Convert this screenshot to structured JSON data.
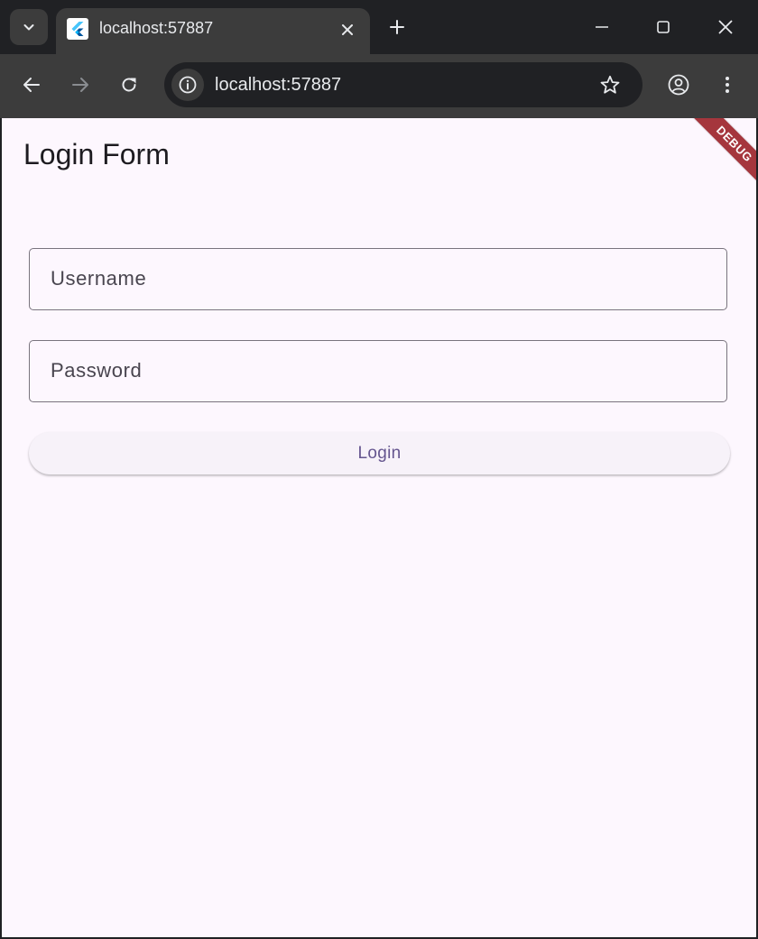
{
  "browser": {
    "tab": {
      "title": "localhost:57887",
      "favicon": "flutter-icon"
    },
    "address_bar": {
      "url": "localhost:57887"
    },
    "icons": {
      "tab_search": "chevron-down-icon",
      "tab_close": "close-icon",
      "new_tab": "plus-icon",
      "minimize": "minimize-icon",
      "maximize": "maximize-icon",
      "close_window": "close-icon",
      "back": "arrow-left-icon",
      "forward": "arrow-right-icon",
      "reload": "reload-icon",
      "site_info": "info-icon",
      "bookmark": "star-icon",
      "profile": "account-icon",
      "menu": "more-vertical-icon"
    },
    "colors": {
      "frame": "#202124",
      "toolbar": "#3c3c3c",
      "text": "#e8eaed"
    }
  },
  "app": {
    "title": "Login Form",
    "form": {
      "username_label": "Username",
      "password_label": "Password",
      "login_label": "Login"
    },
    "debug_banner": "DEBUG",
    "colors": {
      "background": "#fdf7fe",
      "primary": "#65558f",
      "outline": "#79747e",
      "banner": "#a5363d"
    }
  }
}
